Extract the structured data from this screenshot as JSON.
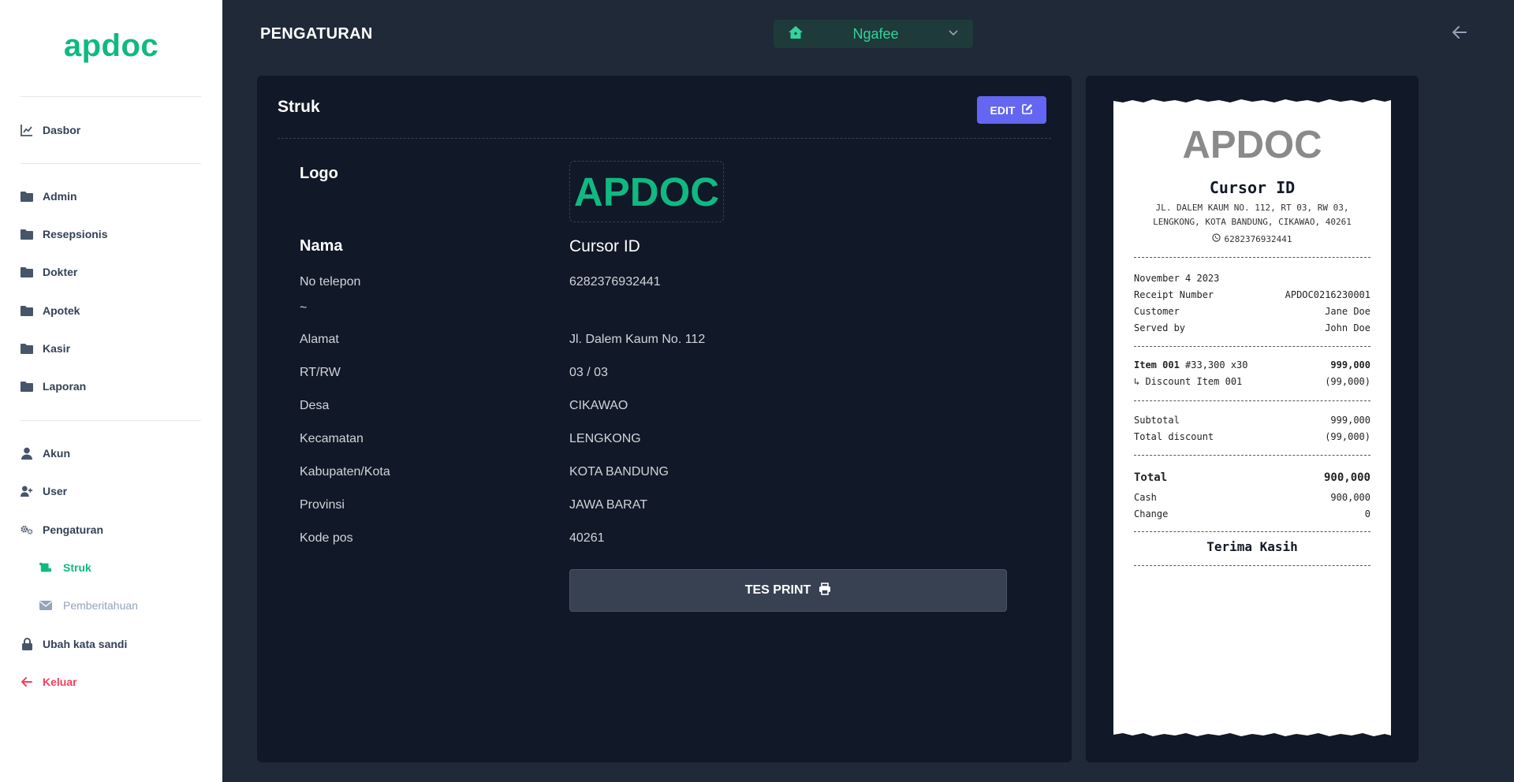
{
  "sidebar": {
    "brand": "apdoc",
    "items": [
      {
        "label": "Dasbor"
      },
      {
        "label": "Admin"
      },
      {
        "label": "Resepsionis"
      },
      {
        "label": "Dokter"
      },
      {
        "label": "Apotek"
      },
      {
        "label": "Kasir"
      },
      {
        "label": "Laporan"
      },
      {
        "label": "Akun"
      },
      {
        "label": "User"
      },
      {
        "label": "Pengaturan"
      },
      {
        "label": "Struk"
      },
      {
        "label": "Pemberitahuan"
      },
      {
        "label": "Ubah kata sandi"
      },
      {
        "label": "Keluar"
      }
    ]
  },
  "header": {
    "title": "PENGATURAN",
    "clinic": "Ngafee"
  },
  "card": {
    "title": "Struk",
    "edit_label": "EDIT",
    "logo_label": "Logo",
    "logo_text": "APDOC",
    "fields": [
      {
        "label": "Nama",
        "value": "Cursor ID"
      },
      {
        "label": "No telepon",
        "value": "6282376932441"
      },
      {
        "label": "~",
        "value": ""
      },
      {
        "label": "Alamat",
        "value": "Jl. Dalem Kaum No. 112"
      },
      {
        "label": "RT/RW",
        "value": "03 / 03"
      },
      {
        "label": "Desa",
        "value": "CIKAWAO"
      },
      {
        "label": "Kecamatan",
        "value": "LENGKONG"
      },
      {
        "label": "Kabupaten/Kota",
        "value": "KOTA BANDUNG"
      },
      {
        "label": "Provinsi",
        "value": "JAWA BARAT"
      },
      {
        "label": "Kode pos",
        "value": "40261"
      }
    ],
    "print_label": "TES PRINT"
  },
  "receipt": {
    "logo": "APDOC",
    "name": "Cursor ID",
    "address_line1": "JL. DALEM KAUM NO. 112, RT 03, RW 03,",
    "address_line2": "LENGKONG, KOTA BANDUNG, CIKAWAO, 40261",
    "phone": "6282376932441",
    "date": "November 4 2023",
    "receipt_number_label": "Receipt Number",
    "receipt_number": "APDOC0216230001",
    "customer_label": "Customer",
    "customer": "Jane Doe",
    "served_label": "Served by",
    "served": "John Doe",
    "item_name": "Item 001",
    "item_detail": "#33,300 x30",
    "item_amount": "999,000",
    "discount_label": "↳ Discount Item 001",
    "discount_amount": "(99,000)",
    "subtotal_label": "Subtotal",
    "subtotal": "999,000",
    "total_discount_label": "Total discount",
    "total_discount": "(99,000)",
    "total_label": "Total",
    "total": "900,000",
    "cash_label": "Cash",
    "cash": "900,000",
    "change_label": "Change",
    "change": "0",
    "thanks": "Terima Kasih"
  }
}
